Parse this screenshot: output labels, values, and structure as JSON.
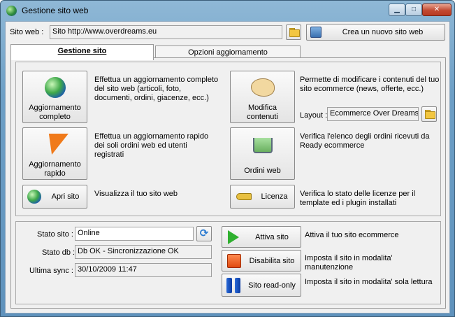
{
  "window": {
    "title": "Gestione sito web",
    "controls": {
      "minimize": "▁",
      "maximize": "□",
      "close": "✕"
    }
  },
  "site": {
    "label": "Sito web :",
    "value": "Sito http://www.overdreams.eu",
    "new_site_button": "Crea un nuovo sito web"
  },
  "tabs": [
    {
      "label": "Gestione sito"
    },
    {
      "label": "Opzioni aggiornamento"
    }
  ],
  "actions": {
    "full_update": {
      "label_line1": "Aggiornamento",
      "label_line2": "completo",
      "icon": "globe-icon",
      "desc": "Effettua un aggiornamento completo del sito web (articoli, foto, documenti, ordini, giacenze, ecc.)"
    },
    "quick_update": {
      "label_line1": "Aggiornamento",
      "label_line2": "rapido",
      "icon": "lightning-icon",
      "desc": "Effettua un aggiornamento rapido dei soli ordini web ed utenti registrati"
    },
    "open_site": {
      "label": "Apri sito",
      "icon": "globe-icon",
      "desc": "Visualizza il tuo sito web"
    },
    "edit_content": {
      "label_line1": "Modifica",
      "label_line2": "contenuti",
      "icon": "palette-icon",
      "desc": "Permette di modificare i contenuti del tuo sito ecommerce (news, offerte, ecc.)"
    },
    "layout": {
      "label": "Layout :",
      "value": "Ecommerce Over Dreams"
    },
    "web_orders": {
      "label": "Ordini web",
      "icon": "cart-icon",
      "desc": "Verifica l'elenco degli ordini ricevuti da Ready ecommerce"
    },
    "license": {
      "label": "Licenza",
      "icon": "key-icon",
      "desc": "Verifica lo stato delle licenze per il template ed i plugin installati"
    }
  },
  "status": {
    "site_label": "Stato sito :",
    "site_value": "Online",
    "db_label": "Stato db :",
    "db_value": "Db OK - Sincronizzazione OK",
    "sync_label": "Ultima sync :",
    "sync_value": "30/10/2009 11:47"
  },
  "site_controls": {
    "activate": {
      "label": "Attiva sito",
      "desc": "Attiva il tuo sito ecommerce",
      "color": "#2fb02f"
    },
    "disable": {
      "label": "Disabilita sito",
      "desc": "Imposta il sito in modalita' manutenzione",
      "color": "#e04a10"
    },
    "readonly": {
      "label": "Sito read-only",
      "desc": "Imposta il sito in modalita' sola lettura",
      "color": "#2a6ad8"
    }
  }
}
